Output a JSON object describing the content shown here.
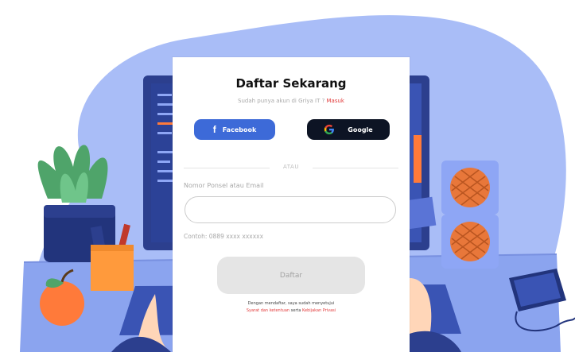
{
  "card": {
    "title": "Daftar Sekarang",
    "subtitle_prefix": "Sudah punya akun di Griya IT ? ",
    "subtitle_link": "Masuk",
    "facebook_label": "Facebook",
    "facebook_glyph": "f",
    "google_label": "Google",
    "divider_text": "ATAU",
    "field_label": "Nomor Ponsel atau Email",
    "field_value": "",
    "field_example": "Contoh: 0889 xxxx xxxxxx",
    "submit_label": "Daftar",
    "terms_line1": "Dengan mendaftar, saya sudah menyetujui",
    "terms_link1": "Syarat dan ketentuan",
    "terms_conj": " serta ",
    "terms_link2": "Kebijakan Privasi"
  },
  "colors": {
    "facebook": "#3d6ad8",
    "google_button": "#0d1424",
    "link": "#e23b3b",
    "blob": "#a9bdf7",
    "desk": "#8ba4ef",
    "monitor": "#2c3f8e"
  },
  "icons": [
    "facebook-icon",
    "google-icon"
  ]
}
